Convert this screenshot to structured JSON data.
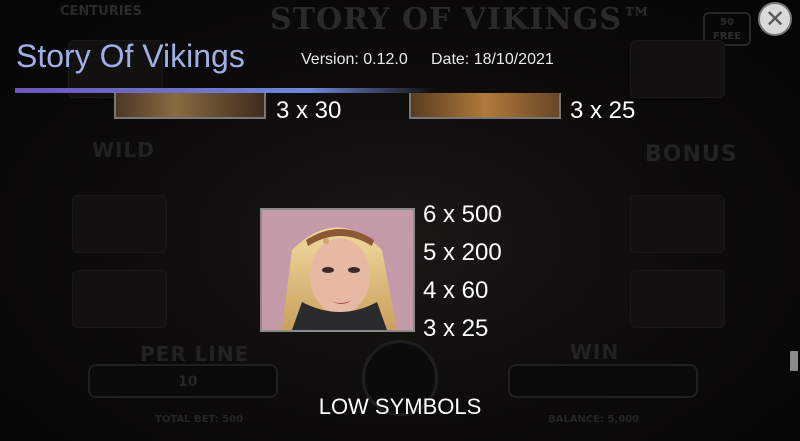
{
  "background": {
    "logo_text": "STORY OF VIKINGS™",
    "top_left": "CENTURIES",
    "free_spins": "50 FREE",
    "wild_text": "WILD",
    "bonus_text": "BONUS",
    "per_line_label": "PER LINE",
    "per_line_value": "10",
    "win_label": "WIN",
    "total_bet": "TOTAL BET: 500",
    "balance": "BALANCE: 5,000"
  },
  "header": {
    "title": "Story Of Vikings",
    "version": "Version: 0.12.0",
    "date": "Date: 18/10/2021"
  },
  "close_icon": "✕",
  "top_payouts": [
    "3 x 30",
    "3 x 25"
  ],
  "symbol": {
    "payouts": [
      "6 x 500",
      "5 x 200",
      "4 x 60",
      "3 x 25"
    ]
  },
  "section_label": "LOW SYMBOLS",
  "colors": {
    "title": "#9fb0e8",
    "accent_bar_start": "#6b56b8",
    "accent_bar_end": "#6f88d6"
  }
}
